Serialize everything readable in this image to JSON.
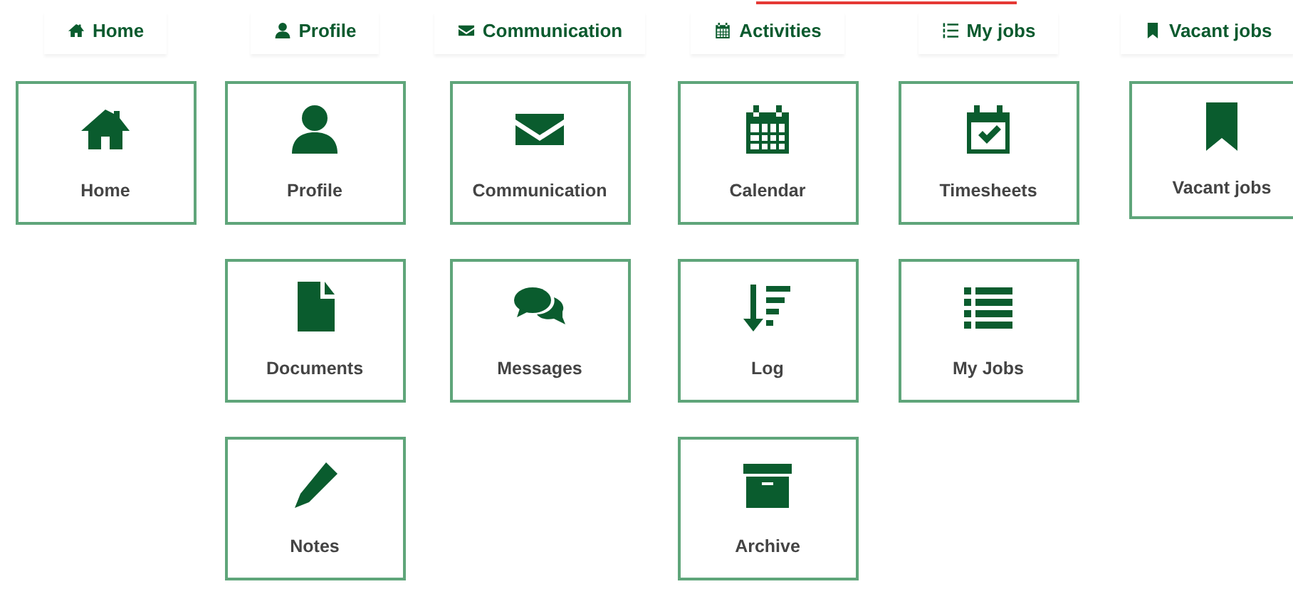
{
  "columns": [
    {
      "header": {
        "label": "Home",
        "kind": "home"
      },
      "tiles": [
        {
          "label": "Home",
          "kind": "home"
        }
      ]
    },
    {
      "header": {
        "label": "Profile",
        "kind": "user"
      },
      "tiles": [
        {
          "label": "Profile",
          "kind": "user"
        },
        {
          "label": "Documents",
          "kind": "file"
        },
        {
          "label": "Notes",
          "kind": "pencil"
        }
      ]
    },
    {
      "header": {
        "label": "Communication",
        "kind": "envelope"
      },
      "tiles": [
        {
          "label": "Communication",
          "kind": "envelope"
        },
        {
          "label": "Messages",
          "kind": "comments"
        }
      ]
    },
    {
      "header": {
        "label": "Activities",
        "kind": "calendar"
      },
      "tiles": [
        {
          "label": "Calendar",
          "kind": "calendar"
        },
        {
          "label": "Log",
          "kind": "sort"
        },
        {
          "label": "Archive",
          "kind": "archive"
        }
      ]
    },
    {
      "header": {
        "label": "My jobs",
        "kind": "numbered"
      },
      "tiles": [
        {
          "label": "Timesheets",
          "kind": "check"
        },
        {
          "label": "My Jobs",
          "kind": "list"
        }
      ]
    },
    {
      "header": {
        "label": "Vacant jobs",
        "kind": "bookmark"
      },
      "tiles": [
        {
          "label": "Vacant jobs",
          "kind": "bookmark"
        }
      ]
    }
  ]
}
